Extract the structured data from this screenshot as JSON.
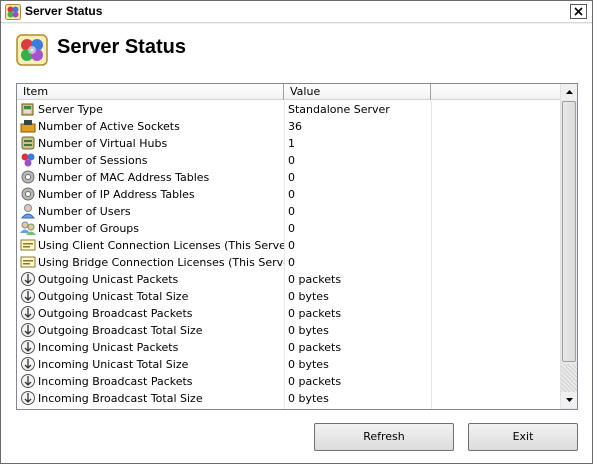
{
  "window": {
    "title": "Server Status"
  },
  "header": {
    "title": "Server Status"
  },
  "list": {
    "columns": [
      "Item",
      "Value"
    ],
    "rows": [
      {
        "icon": "server-type-icon",
        "item": "Server Type",
        "value": "Standalone Server"
      },
      {
        "icon": "sockets-icon",
        "item": "Number of Active Sockets",
        "value": "36"
      },
      {
        "icon": "virtual-hub-icon",
        "item": "Number of Virtual Hubs",
        "value": "1"
      },
      {
        "icon": "sessions-icon",
        "item": "Number of Sessions",
        "value": "0"
      },
      {
        "icon": "gear-icon",
        "item": "Number of MAC Address Tables",
        "value": "0"
      },
      {
        "icon": "gear-icon",
        "item": "Number of IP Address Tables",
        "value": "0"
      },
      {
        "icon": "user-icon",
        "item": "Number of Users",
        "value": "0"
      },
      {
        "icon": "group-icon",
        "item": "Number of Groups",
        "value": "0"
      },
      {
        "icon": "license-icon",
        "item": "Using Client Connection Licenses (This Server)",
        "value": "0"
      },
      {
        "icon": "license-icon",
        "item": "Using Bridge Connection Licenses (This Server)",
        "value": "0"
      },
      {
        "icon": "packet-icon",
        "item": "Outgoing Unicast Packets",
        "value": "0 packets"
      },
      {
        "icon": "packet-icon",
        "item": "Outgoing Unicast Total Size",
        "value": "0 bytes"
      },
      {
        "icon": "packet-icon",
        "item": "Outgoing Broadcast Packets",
        "value": "0 packets"
      },
      {
        "icon": "packet-icon",
        "item": "Outgoing Broadcast Total Size",
        "value": "0 bytes"
      },
      {
        "icon": "packet-icon",
        "item": "Incoming Unicast Packets",
        "value": "0 packets"
      },
      {
        "icon": "packet-icon",
        "item": "Incoming Unicast Total Size",
        "value": "0 bytes"
      },
      {
        "icon": "packet-icon",
        "item": "Incoming Broadcast Packets",
        "value": "0 packets"
      },
      {
        "icon": "packet-icon",
        "item": "Incoming Broadcast Total Size",
        "value": "0 bytes"
      }
    ]
  },
  "buttons": {
    "refresh": "Refresh",
    "exit": "Exit"
  },
  "colors": {
    "window_bg": "#f0f0f0",
    "list_border": "#828790"
  }
}
